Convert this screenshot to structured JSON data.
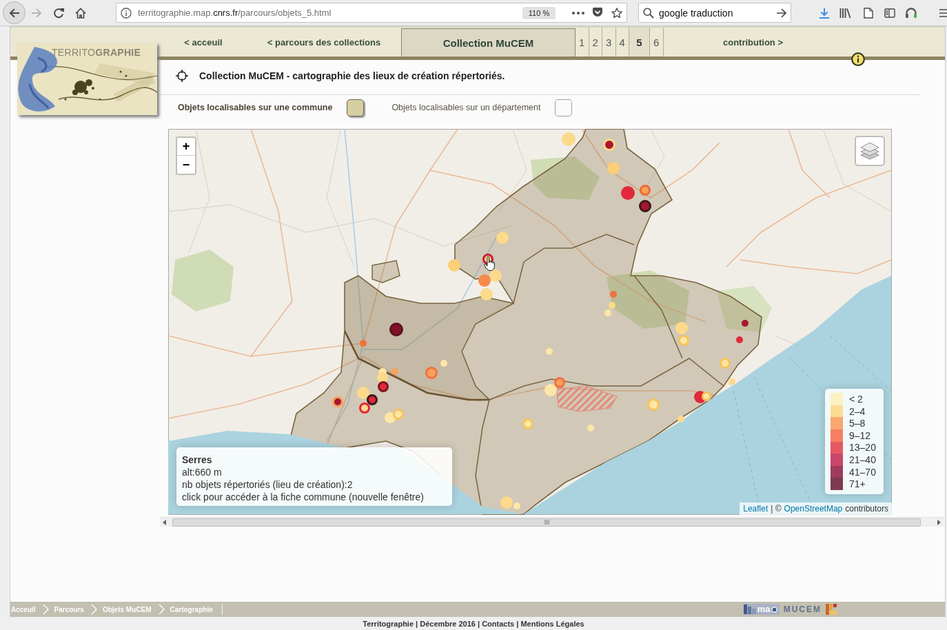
{
  "browser": {
    "forward": {
      "disabled": true
    },
    "url_parts": [
      {
        "text": "territographie.map.",
        "kind": "muted"
      },
      {
        "text": "cnrs.fr",
        "kind": "domain"
      },
      {
        "text": "/parcours/objets_5.html",
        "kind": "muted"
      }
    ],
    "zoom": "110 %",
    "search": "google traduction"
  },
  "logo": {
    "title": "TERRITO**GRAPHIE**"
  },
  "nav": {
    "tabs": [
      {
        "label": "< acceuil",
        "selected": false
      },
      {
        "label": "< parcours des collections",
        "selected": false
      },
      {
        "label": "Collection MuCEM",
        "selected": true
      }
    ],
    "pages": [
      {
        "label": "1",
        "selected": false
      },
      {
        "label": "2",
        "selected": false
      },
      {
        "label": "3",
        "selected": false
      },
      {
        "label": "4",
        "selected": false
      },
      {
        "label": "5",
        "selected": true
      },
      {
        "label": "6",
        "selected": false
      }
    ],
    "next": "contribution >"
  },
  "header": {
    "title": "Collection MuCEM - cartographie des lieux de création répertoriés."
  },
  "filters": [
    {
      "label": "Objets localisables sur une commune",
      "checked": true
    },
    {
      "label": "Objets localisables sur un département",
      "checked": false
    }
  ],
  "map": {
    "zoom_in": "+",
    "zoom_out": "−",
    "markers": [
      {
        "kind": "plain",
        "color": "#fdd98b"
      },
      {
        "kind": "ringed",
        "color": "#a8162f",
        "ring": {
          "color": "#fdd98b"
        }
      },
      {
        "kind": "plain",
        "color": "#fccf78"
      },
      {
        "kind": "plain",
        "color": "#e2283a"
      },
      {
        "kind": "ringed",
        "color": "#f7a15c",
        "ring": {
          "color": "#ee6a3a"
        }
      },
      {
        "kind": "ringed",
        "color": "#a8162f",
        "ring": {
          "color": "#3b1a1a"
        }
      },
      {
        "kind": "plain",
        "color": "#fdd98b"
      },
      {
        "kind": "plain",
        "color": "#fccf78"
      },
      {
        "kind": "plain",
        "color": "#fdd98b"
      },
      {
        "kind": "plain",
        "color": "#f4894a"
      },
      {
        "kind": "plain",
        "color": "#fdd98b"
      },
      {
        "kind": "ringed",
        "color": "#7e1426",
        "ring": {
          "color": "#5e1020"
        }
      },
      {
        "kind": "plain",
        "color": "#f2703f"
      },
      {
        "kind": "plain",
        "color": "#fde7a6"
      },
      {
        "kind": "ringed",
        "color": "#f7a15c",
        "ring": {
          "color": "#f2703f"
        }
      },
      {
        "kind": "plain",
        "color": "#f7a15c"
      },
      {
        "kind": "plain",
        "color": "#fde7a6"
      },
      {
        "kind": "plain",
        "color": "#fdd98b"
      },
      {
        "kind": "ringed",
        "color": "#e2283a",
        "ring": {
          "color": "#7e1426"
        }
      },
      {
        "kind": "plain",
        "color": "#fdd98b"
      },
      {
        "kind": "ringed",
        "color": "#e2283a",
        "ring": {
          "color": "#3b1a1a"
        }
      },
      {
        "kind": "ringed",
        "color": "#a8162f",
        "ring": {
          "color": "#f7a15c"
        }
      },
      {
        "kind": "ringed",
        "color": "#fdd98b",
        "ring": {
          "color": "#e2283a"
        }
      },
      {
        "kind": "plain",
        "color": "#fde7a6"
      },
      {
        "kind": "ringed",
        "color": "#fde7a6",
        "ring": {
          "color": "#f6c35c"
        }
      },
      {
        "kind": "plain",
        "color": "#f2703f"
      },
      {
        "kind": "plain",
        "color": "#fdd98b"
      },
      {
        "kind": "plain",
        "color": "#fde7a6"
      },
      {
        "kind": "plain",
        "color": "#fdd98b"
      },
      {
        "kind": "ringed",
        "color": "#fde7a6",
        "ring": {
          "color": "#f6c35c"
        }
      },
      {
        "kind": "plain",
        "color": "#a8162f"
      },
      {
        "kind": "plain",
        "color": "#e2283a"
      },
      {
        "kind": "ringed",
        "color": "#fde7a6",
        "ring": {
          "color": "#f6c35c"
        }
      },
      {
        "kind": "plain",
        "color": "#fdd98b"
      },
      {
        "kind": "plain",
        "color": "#e2283a"
      },
      {
        "kind": "ringed",
        "color": "#fde7a6",
        "ring": {
          "color": "#f6c35c"
        }
      },
      {
        "kind": "ringed",
        "color": "#f7a15c",
        "ring": {
          "color": "#f2703f"
        }
      },
      {
        "kind": "plain",
        "color": "#fde7a6"
      },
      {
        "kind": "plain",
        "color": "#fde7a6"
      },
      {
        "kind": "ringed",
        "color": "#fde7a6",
        "ring": {
          "color": "#f6c35c"
        }
      },
      {
        "kind": "plain",
        "color": "#fdd98b"
      },
      {
        "kind": "ringed",
        "color": "#fde7a6",
        "ring": {
          "color": "#f6c35c"
        }
      },
      {
        "kind": "plain",
        "color": "#fde7a6"
      },
      {
        "kind": "plain",
        "color": "#fdd98b"
      },
      {
        "kind": "plain",
        "color": "#fde7a6"
      },
      {
        "kind": "ringed",
        "color": "#fccf78",
        "ring": {
          "color": "#c41e3a"
        }
      }
    ],
    "tooltip": {
      "title": "Serres",
      "lines": [
        "alt:660 m",
        "nb objets répertoriés (lieu de création):2",
        "click pour accéder à la fiche commune (nouvelle fenêtre)"
      ]
    },
    "legend": [
      {
        "label": "< 2",
        "color": "#fdf0c2"
      },
      {
        "label": "2–4",
        "color": "#fbdc95"
      },
      {
        "label": "5–8",
        "color": "#f9a86f"
      },
      {
        "label": "9–12",
        "color": "#f67e62"
      },
      {
        "label": "13–20",
        "color": "#e6585f"
      },
      {
        "label": "21–40",
        "color": "#c8486a"
      },
      {
        "label": "41–70",
        "color": "#9f3c5d"
      },
      {
        "label": "71+",
        "color": "#7d3a50"
      }
    ],
    "attribution": [
      {
        "text": "Leaflet",
        "kind": "link"
      },
      {
        "text": "| ©",
        "kind": "text"
      },
      {
        "text": "OpenStreetMap",
        "kind": "link"
      },
      {
        "text": "contributors",
        "kind": "text"
      }
    ]
  },
  "breadcrumb": [
    "Acceuil",
    "Parcours",
    "Objets MuCEM",
    "Cartographie"
  ],
  "partners": {
    "logo_text": "ma",
    "name": "MUCEM"
  },
  "footer": "Territographie | Décembre 2016 | Contacts | Mentions Légales"
}
